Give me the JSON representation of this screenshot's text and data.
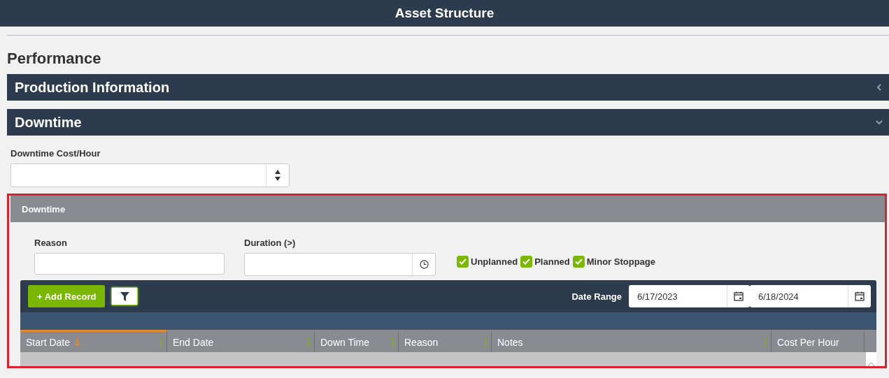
{
  "header": {
    "title": "Asset Structure"
  },
  "page_title": "Performance",
  "sections": [
    {
      "title": "Production Information",
      "expanded": false
    },
    {
      "title": "Downtime",
      "expanded": true
    }
  ],
  "cost_field": {
    "label": "Downtime Cost/Hour"
  },
  "downtime_panel": {
    "title": "Downtime",
    "filters": {
      "reason": {
        "label": "Reason"
      },
      "duration": {
        "label": "Duration (>)"
      },
      "checkboxes": [
        {
          "label": "Unplanned",
          "checked": true
        },
        {
          "label": "Planned",
          "checked": true
        },
        {
          "label": "Minor Stoppage",
          "checked": true
        }
      ]
    },
    "toolbar": {
      "add_button": "+ Add Record",
      "date_range_label": "Date Range",
      "date_from": "6/17/2023",
      "date_to": "6/18/2024"
    },
    "table": {
      "columns": [
        {
          "label": "Start Date",
          "sorted": true,
          "menu": true
        },
        {
          "label": "End Date",
          "sorted": false,
          "menu": true
        },
        {
          "label": "Down Time",
          "sorted": false,
          "menu": true
        },
        {
          "label": "Reason",
          "sorted": false,
          "menu": true
        },
        {
          "label": "Notes",
          "sorted": false,
          "menu": true
        },
        {
          "label": "Cost Per Hour",
          "sorted": false,
          "menu": false
        }
      ]
    }
  }
}
